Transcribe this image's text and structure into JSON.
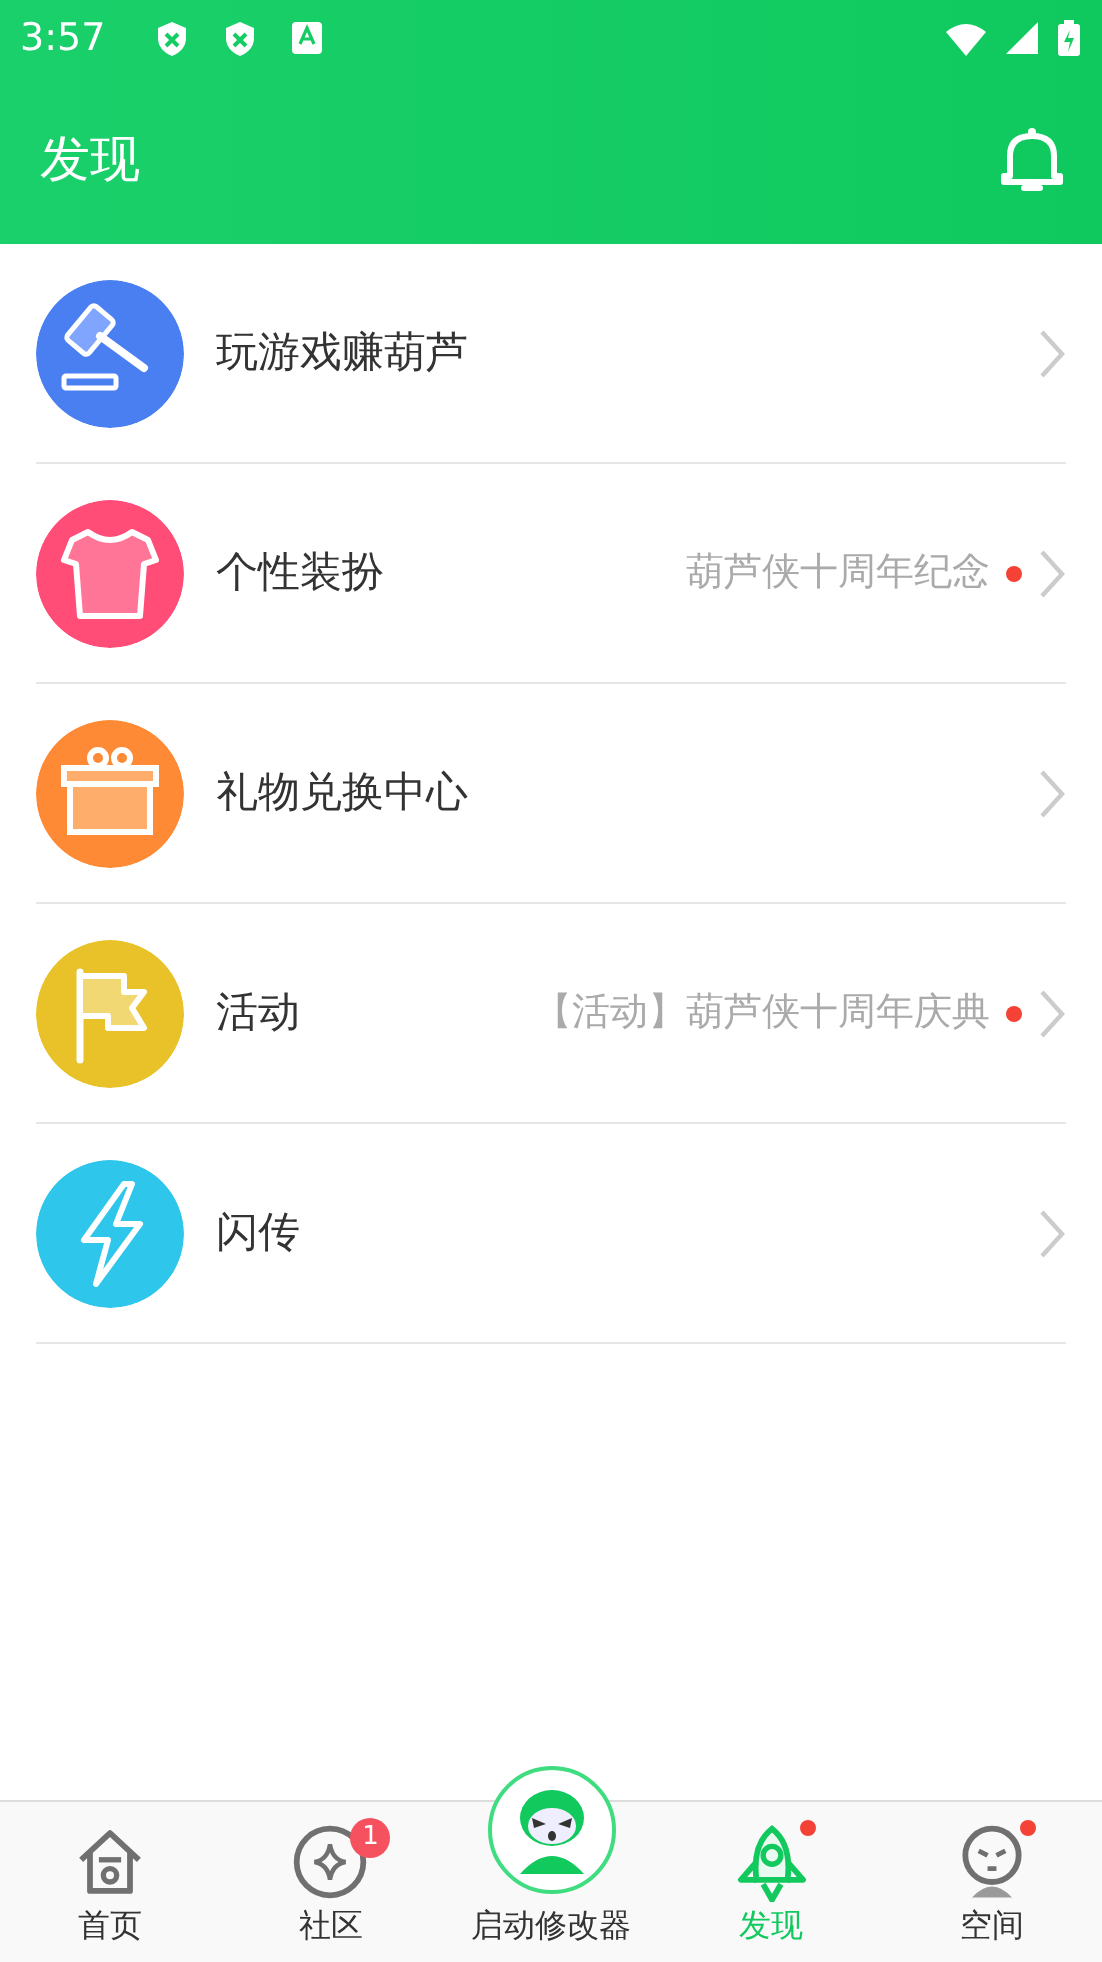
{
  "status_bar": {
    "time": "3:57"
  },
  "header": {
    "title": "发现"
  },
  "items": [
    {
      "kind": "gavel",
      "color": "#4a7ff2",
      "label": "玩游戏赚葫芦",
      "dot": false
    },
    {
      "kind": "shirt",
      "color": "#ff4d78",
      "label": "个性装扮",
      "subtitle": "葫芦侠十周年纪念",
      "dot": true
    },
    {
      "kind": "gift",
      "color": "#ff8a35",
      "label": "礼物兑换中心",
      "dot": false
    },
    {
      "kind": "flag",
      "color": "#e8c228",
      "label": "活动",
      "subtitle": "【活动】葫芦侠十周年庆典",
      "dot": true
    },
    {
      "kind": "bolt",
      "color": "#2fc6ec",
      "label": "闪传",
      "dot": false
    }
  ],
  "bottom_nav": [
    {
      "kind": "home",
      "label": "首页",
      "selected": false,
      "dot": false
    },
    {
      "kind": "community",
      "label": "社区",
      "selected": false,
      "badge": "1",
      "dot": false
    },
    {
      "kind": "launcher",
      "label": "启动修改器",
      "selected": false,
      "dot": false
    },
    {
      "kind": "rocket",
      "label": "发现",
      "selected": true,
      "dot": true
    },
    {
      "kind": "space",
      "label": "空间",
      "selected": false,
      "dot": true
    }
  ]
}
